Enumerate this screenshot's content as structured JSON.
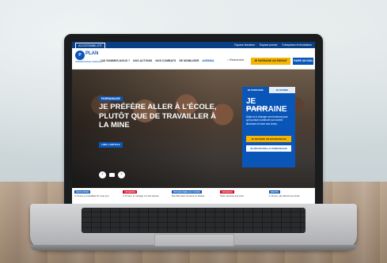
{
  "website": {
    "topbar": {
      "accessibility": "ACCESSIBILITÉ",
      "links": [
        "Espace donateur",
        "Espace presse",
        "Entreprises et fondations"
      ]
    },
    "logo": {
      "badge": "P",
      "name": "PLAN",
      "tagline": "INTERNATIONAL FRANCE"
    },
    "nav": {
      "items": [
        "QUI SOMMES-NOUS ?",
        "NOS ACTIONS",
        "NOS COMBATS",
        "SE MOBILISER",
        "AGENDA"
      ],
      "active_index": 4,
      "search_label": "Rechercher",
      "cta_primary": "JE PARRAINE UN ENFANT",
      "cta_secondary": "FAIRE UN DON"
    },
    "hero": {
      "tag": "PARRAINAGE",
      "title": "JE PRÉFÈRE ALLER À L'ÉCOLE, PLUTÔT QUE DE TRAVAILLER À LA MINE",
      "cta": "LIRE L'ARTICLE",
      "prev_glyph": "‹",
      "next_glyph": "›"
    },
    "panel": {
      "tabs": [
        "JE PARRAINE",
        "JE DONNE"
      ],
      "title": "JE PARRAINE",
      "subtitle": "UN ENFANT",
      "body": "Aidez-le à changer ses horizons pour qu'il puisse construire son avenir librement et vivre ses rêves.",
      "button_primary": "JE DEVIENS UN MARRAINAGE",
      "button_secondary": "JE DÉCOUVRE LE PARRAINAGE"
    },
    "news": [
      {
        "tag": "ÉDUCATION",
        "text": "À 14 ans, je travaillais 10 h par jour",
        "color": "#0a56b8"
      },
      {
        "tag": "URGENCE",
        "text": "À 13 ans, le mariage m'a été imposé",
        "color": "#d0021b"
      },
      {
        "tag": "PROGRAMME EN COURS",
        "text": "Des filles bien formées en Afrique",
        "color": "#0a56b8"
      },
      {
        "tag": "URGENCE",
        "text": "Notre réponse à la crise",
        "color": "#d0021b"
      },
      {
        "tag": "DROITS",
        "text": "À 16 ans, elle défend ses droits",
        "color": "#0a56b8"
      }
    ]
  }
}
